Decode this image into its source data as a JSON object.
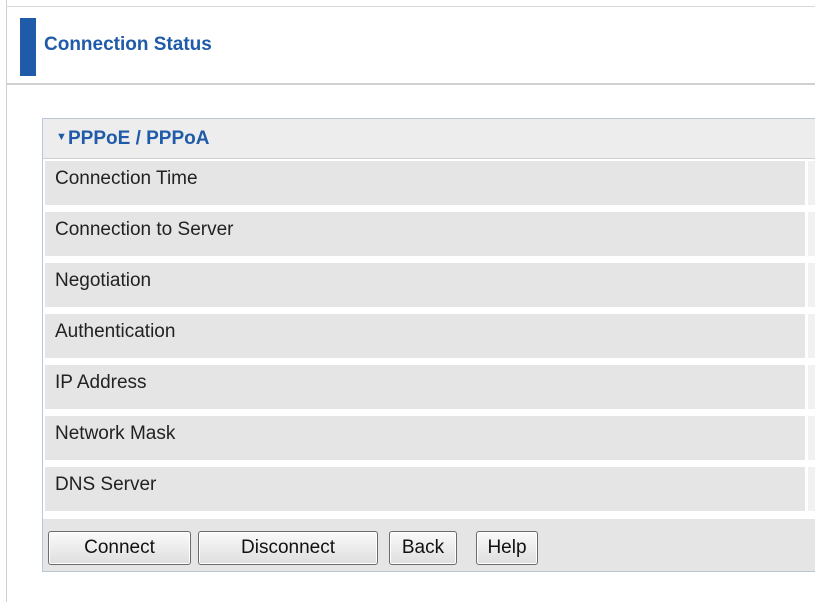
{
  "header": {
    "title": "Connection Status"
  },
  "section": {
    "title": "PPPoE / PPPoA",
    "expand_icon": "triangle-down-icon"
  },
  "rows": [
    {
      "label": "Connection Time"
    },
    {
      "label": "Connection to Server"
    },
    {
      "label": "Negotiation"
    },
    {
      "label": "Authentication"
    },
    {
      "label": "IP Address"
    },
    {
      "label": "Network Mask"
    },
    {
      "label": "DNS Server"
    }
  ],
  "buttons": {
    "connect": "Connect",
    "disconnect": "Disconnect",
    "back": "Back",
    "help": "Help"
  },
  "colors": {
    "accent": "#1f5ba8",
    "row_background": "#e5e5e5",
    "header_background": "#ededed"
  }
}
